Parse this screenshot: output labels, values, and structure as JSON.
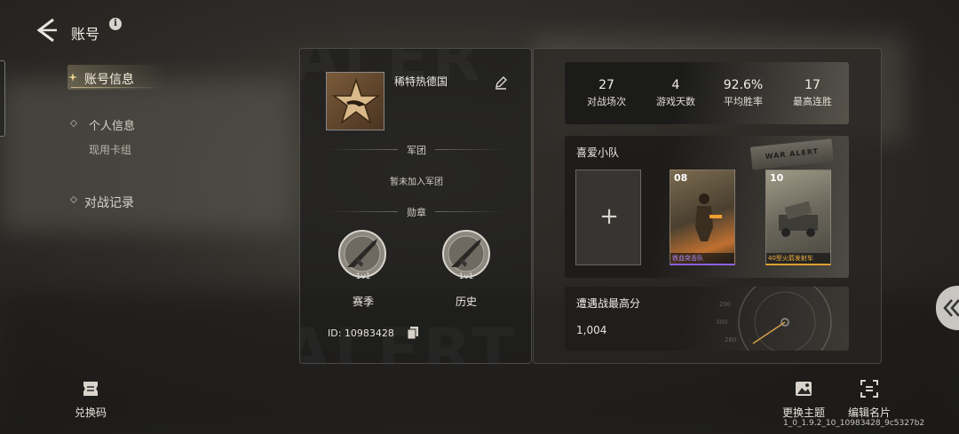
{
  "header": {
    "title": "账号",
    "info_symbol": "i"
  },
  "sidebar": {
    "items": [
      {
        "label": "账号信息",
        "active": true
      },
      {
        "label": "个人信息"
      },
      {
        "label": "现用卡组"
      },
      {
        "label": "对战记录"
      }
    ]
  },
  "profile": {
    "player_name": "稀特热德国",
    "legion_title": "军团",
    "legion_status": "暂未加入军团",
    "medals_title": "勋章",
    "medals": [
      {
        "mode": "1v1",
        "name": "赛季"
      },
      {
        "mode": "1v1",
        "name": "历史"
      }
    ],
    "id_text": "ID: 10983428"
  },
  "stats": [
    {
      "value": "27",
      "label": "对战场次"
    },
    {
      "value": "4",
      "label": "游戏天数"
    },
    {
      "value": "92.6%",
      "label": "平均胜率"
    },
    {
      "value": "17",
      "label": "最高连胜"
    }
  ],
  "squad": {
    "title": "喜爱小队",
    "add_symbol": "+",
    "cards": [
      {
        "level": "08",
        "name": "铁血突击队",
        "name_color": "#b48cff"
      },
      {
        "level": "10",
        "name": "40型火箭发射车",
        "name_color": "#f0b040"
      }
    ],
    "tag_text": "WAR ALERT"
  },
  "encounter": {
    "title": "遭遇战最高分",
    "score": "1,004"
  },
  "bottom": {
    "redeem_label": "兑换码",
    "theme_label": "更换主题",
    "edit_card_label": "编辑名片"
  },
  "version": "1_0_1.9.2_10_10983428_9c5327b2",
  "colors": {
    "accent": "#e0c070",
    "panel_border": "#8a857a"
  }
}
